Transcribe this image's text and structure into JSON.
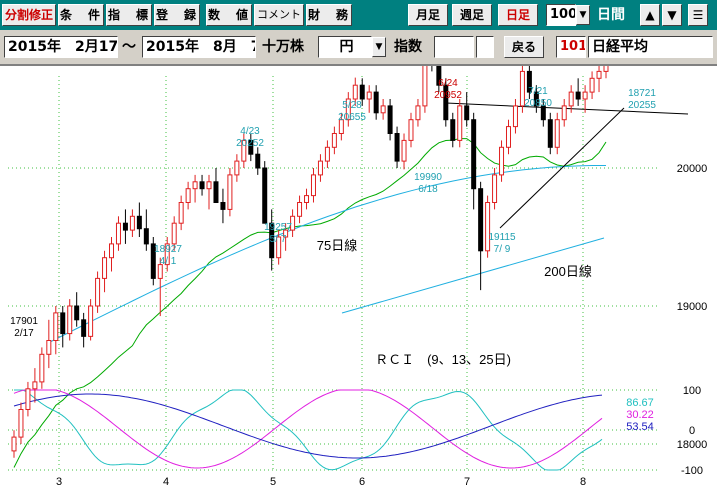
{
  "toolbar": {
    "split_adjust": "分割修正",
    "conditions": "条　件",
    "indicators": "指　標",
    "register": "登　録",
    "values": "数　値",
    "comment": "コメント",
    "financials": "財　務",
    "monthly": "月足",
    "weekly": "週足",
    "daily": "日足",
    "bar_count": "100",
    "bar_unit": "日間",
    "up_icon": "triangle-up-icon",
    "down_icon": "triangle-down-icon",
    "menu_icon": "menu-icon"
  },
  "settings": {
    "start_date": "2015年　2月17日",
    "range_sep": "～",
    "end_date": "2015年　8月　7日",
    "volume_unit": "十万株",
    "currency": "円",
    "index_label": "指数",
    "back_button": "戻る",
    "code": "101",
    "name": "日経平均"
  },
  "colors": {
    "titlebar": "#008080",
    "up_candle": "#e02020",
    "down_candle": "#000000",
    "ma_short": "#00aa00",
    "ma_75": "#20b0e0",
    "ma_200": "#20b0e0",
    "rci9": "#20c0c0",
    "rci13": "#e020e0",
    "rci25": "#2020c0",
    "annotation": "#20a0b0",
    "annotation_red": "#cc0000"
  },
  "chart_data": {
    "type": "candlestick",
    "price_axis_ticks": [
      "20000",
      "19000",
      "18000"
    ],
    "price_ylim": [
      17500,
      21500
    ],
    "month_labels": [
      "3",
      "4",
      "5",
      "6",
      "7",
      "8"
    ],
    "annotations": {
      "start_price": "17901",
      "start_date": "2/17",
      "low_apr": "18927",
      "low_apr_date": "4/ 1",
      "high_apr": "4/23",
      "high_apr_val": "20252",
      "low_may": "19257",
      "low_may_date": "5/ 7",
      "high_may": "5/28",
      "high_may_val": "20655",
      "high_jun": "6/24",
      "high_jun_val": "20952",
      "low_jun": "19990",
      "low_jun_date": "6/18",
      "high_jul": "7/21",
      "high_jul_val": "20850",
      "low_jul": "19115",
      "low_jul_date": "7/ 9",
      "last_high": "18721",
      "last_close": "20255"
    },
    "ma75_label": "75日線",
    "ma200_label": "200日線",
    "rci_title": "ＲＣＩ　(9、13、25日)",
    "rci_ticks": [
      "100",
      "0",
      "-100"
    ],
    "rci_values": {
      "rci9": "86.67",
      "rci13": "30.22",
      "rci25": "53.54"
    },
    "candles": [
      [
        17950,
        18100,
        17900,
        18050
      ],
      [
        18050,
        18300,
        18000,
        18250
      ],
      [
        18250,
        18450,
        18200,
        18400
      ],
      [
        18400,
        18550,
        18300,
        18450
      ],
      [
        18450,
        18700,
        18400,
        18650
      ],
      [
        18650,
        18900,
        18550,
        18750
      ],
      [
        18750,
        19000,
        18650,
        18950
      ],
      [
        18950,
        19000,
        18700,
        18800
      ],
      [
        18800,
        19050,
        18750,
        19000
      ],
      [
        19000,
        19100,
        18850,
        18900
      ],
      [
        18900,
        18950,
        18700,
        18780
      ],
      [
        18780,
        19050,
        18750,
        19000
      ],
      [
        19000,
        19250,
        18950,
        19200
      ],
      [
        19200,
        19400,
        19100,
        19350
      ],
      [
        19350,
        19500,
        19250,
        19450
      ],
      [
        19450,
        19650,
        19400,
        19600
      ],
      [
        19600,
        19700,
        19450,
        19550
      ],
      [
        19550,
        19700,
        19500,
        19650
      ],
      [
        19650,
        19750,
        19500,
        19560
      ],
      [
        19560,
        19700,
        19400,
        19450
      ],
      [
        19450,
        19500,
        19150,
        19200
      ],
      [
        19200,
        19350,
        18927,
        19300
      ],
      [
        19300,
        19500,
        19250,
        19450
      ],
      [
        19450,
        19650,
        19400,
        19600
      ],
      [
        19600,
        19800,
        19550,
        19750
      ],
      [
        19750,
        19900,
        19700,
        19850
      ],
      [
        19850,
        19950,
        19750,
        19900
      ],
      [
        19900,
        19950,
        19800,
        19850
      ],
      [
        19850,
        19950,
        19700,
        19900
      ],
      [
        19900,
        20000,
        19800,
        19750
      ],
      [
        19750,
        19850,
        19600,
        19700
      ],
      [
        19700,
        20000,
        19650,
        19950
      ],
      [
        19950,
        20100,
        19900,
        20050
      ],
      [
        20050,
        20252,
        20000,
        20200
      ],
      [
        20200,
        20250,
        20050,
        20100
      ],
      [
        20100,
        20150,
        19950,
        20000
      ],
      [
        20000,
        20050,
        19700,
        19600
      ],
      [
        19600,
        19700,
        19257,
        19350
      ],
      [
        19350,
        19550,
        19300,
        19500
      ],
      [
        19500,
        19600,
        19400,
        19550
      ],
      [
        19550,
        19700,
        19500,
        19650
      ],
      [
        19650,
        19800,
        19600,
        19750
      ],
      [
        19750,
        19850,
        19700,
        19800
      ],
      [
        19800,
        20000,
        19750,
        19950
      ],
      [
        19950,
        20100,
        19900,
        20050
      ],
      [
        20050,
        20200,
        20000,
        20150
      ],
      [
        20150,
        20300,
        20100,
        20250
      ],
      [
        20250,
        20400,
        20200,
        20350
      ],
      [
        20350,
        20550,
        20300,
        20500
      ],
      [
        20500,
        20655,
        20450,
        20600
      ],
      [
        20600,
        20650,
        20450,
        20500
      ],
      [
        20500,
        20600,
        20400,
        20550
      ],
      [
        20550,
        20600,
        20350,
        20400
      ],
      [
        20400,
        20500,
        20350,
        20450
      ],
      [
        20450,
        20500,
        20200,
        20250
      ],
      [
        20250,
        20300,
        20000,
        20050
      ],
      [
        20050,
        20250,
        19990,
        20200
      ],
      [
        20200,
        20400,
        20150,
        20350
      ],
      [
        20350,
        20500,
        20300,
        20450
      ],
      [
        20450,
        20952,
        20400,
        20800
      ],
      [
        20800,
        20900,
        20700,
        20750
      ],
      [
        20750,
        20800,
        20550,
        20600
      ],
      [
        20600,
        20650,
        20300,
        20350
      ],
      [
        20350,
        20400,
        20150,
        20200
      ],
      [
        20200,
        20500,
        20150,
        20450
      ],
      [
        20450,
        20550,
        20300,
        20350
      ],
      [
        20350,
        20400,
        19700,
        19850
      ],
      [
        19850,
        19900,
        19115,
        19400
      ],
      [
        19400,
        19800,
        19350,
        19750
      ],
      [
        19750,
        20000,
        19700,
        19950
      ],
      [
        19950,
        20200,
        19900,
        20150
      ],
      [
        20150,
        20350,
        20100,
        20300
      ],
      [
        20300,
        20500,
        20250,
        20450
      ],
      [
        20450,
        20850,
        20400,
        20700
      ],
      [
        20700,
        20750,
        20500,
        20550
      ],
      [
        20550,
        20600,
        20400,
        20450
      ],
      [
        20450,
        20500,
        20300,
        20350
      ],
      [
        20350,
        20400,
        20100,
        20150
      ],
      [
        20150,
        20400,
        20100,
        20350
      ],
      [
        20350,
        20500,
        20300,
        20450
      ],
      [
        20450,
        20600,
        20400,
        20550
      ],
      [
        20550,
        20650,
        20450,
        20500
      ],
      [
        20500,
        20600,
        20400,
        20550
      ],
      [
        20550,
        20700,
        20500,
        20650
      ],
      [
        20650,
        20750,
        20550,
        20700
      ],
      [
        20700,
        20850,
        20650,
        20800
      ]
    ]
  }
}
